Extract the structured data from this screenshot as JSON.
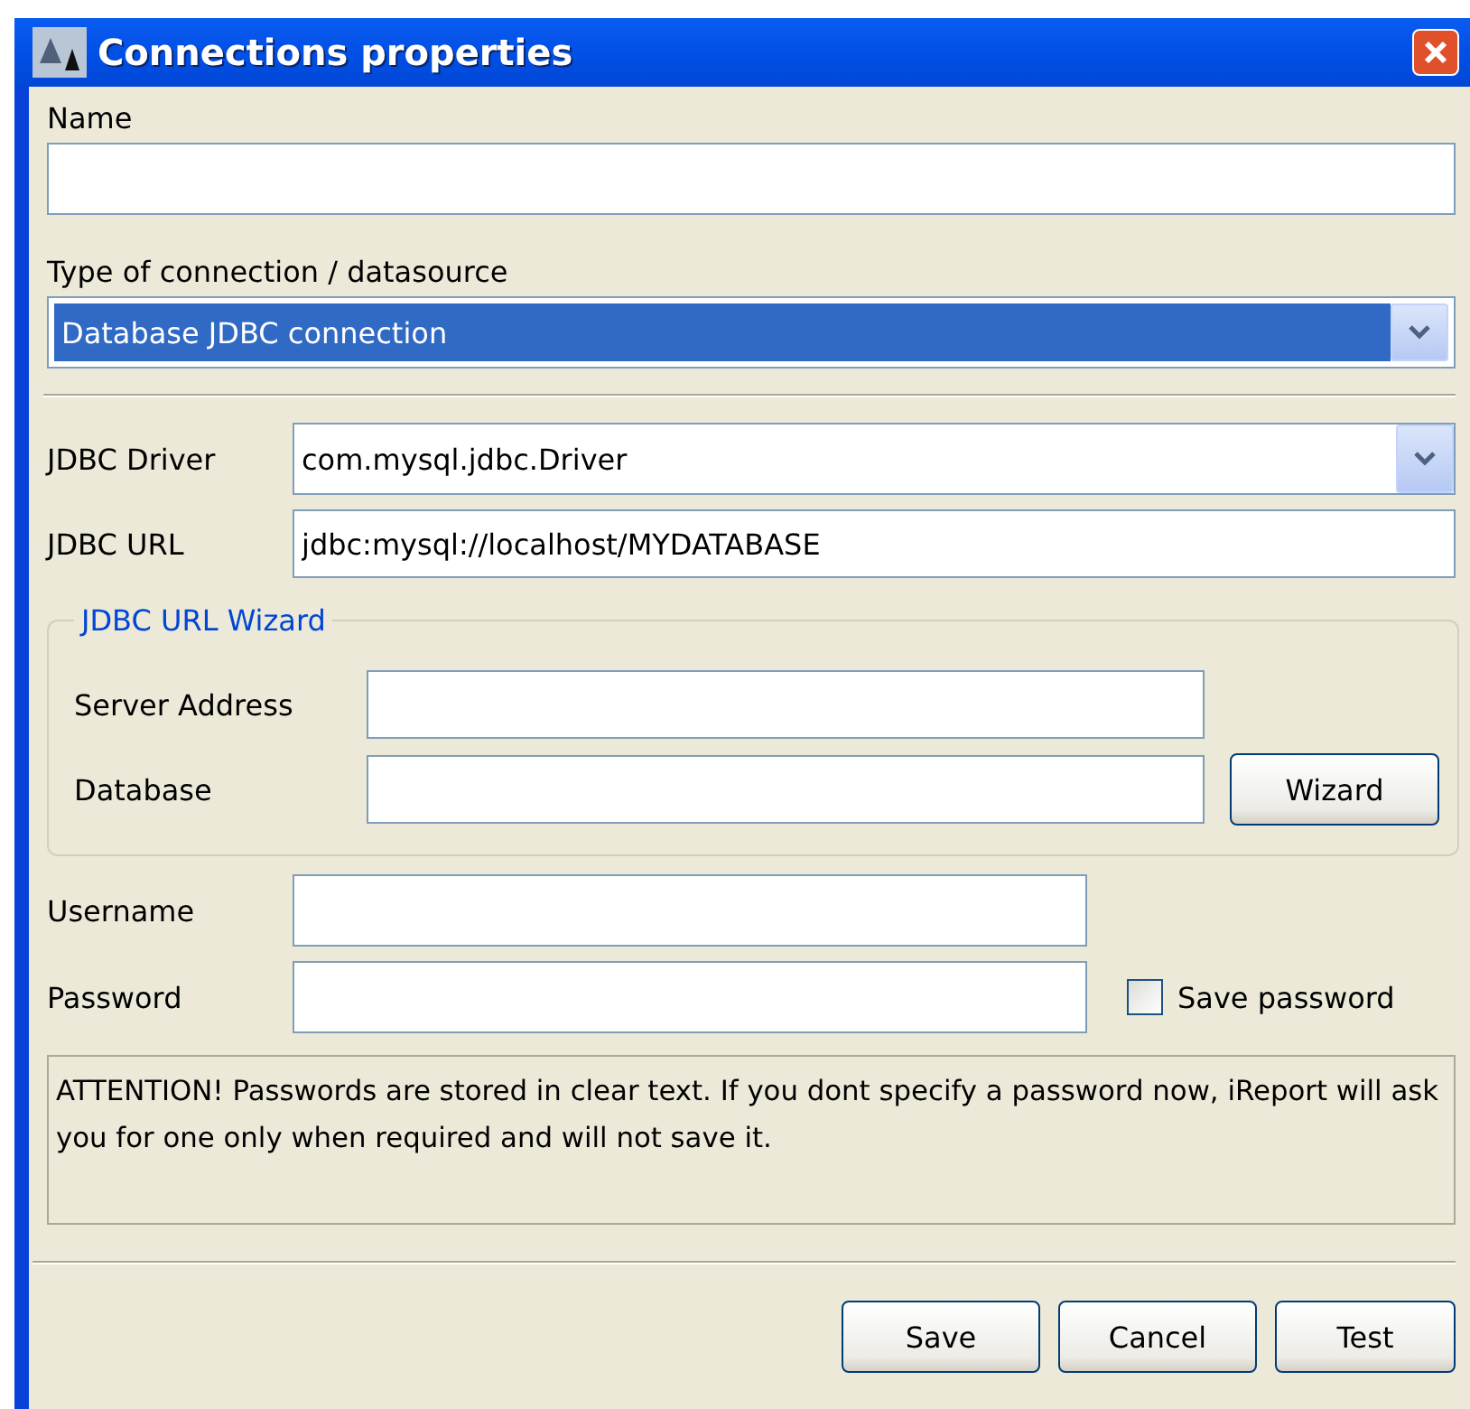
{
  "window": {
    "title": "Connections properties"
  },
  "name": {
    "label": "Name"
  },
  "type": {
    "label": "Type of connection / datasource",
    "value": "Database JDBC connection",
    "focused": true
  },
  "driver": {
    "label": "JDBC Driver",
    "value": "com.mysql.jdbc.Driver"
  },
  "url": {
    "label": "JDBC URL",
    "value": "jdbc:mysql://localhost/MYDATABASE"
  },
  "wizard_group": {
    "title": "JDBC URL Wizard",
    "server_label": "Server Address",
    "database_label": "Database",
    "button": "Wizard"
  },
  "username": {
    "label": "Username"
  },
  "password": {
    "label": "Password"
  },
  "save_password": {
    "label": "Save password",
    "checked": false
  },
  "notice": "ATTENTION! Passwords are stored in clear text. If you dont specify a password now, iReport will ask you for one only when required and will not save it.",
  "buttons": [
    "Save",
    "Cancel",
    "Test"
  ]
}
